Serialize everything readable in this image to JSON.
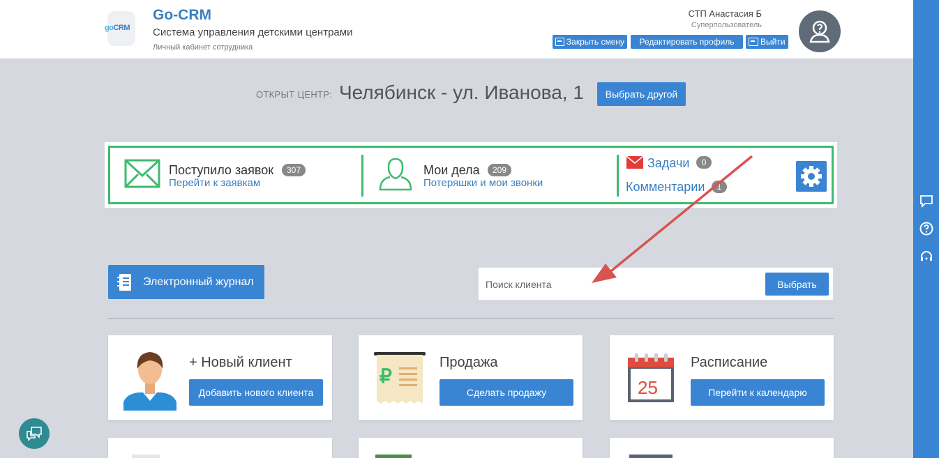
{
  "header": {
    "logo_text_1": "go",
    "logo_text_2": "CRM",
    "brand_title": "Go-CRM",
    "brand_subtitle": "Система управления детскими центрами",
    "brand_caption": "Личный кабинет сотрудника",
    "user_name": "СТП Анастасия Б",
    "user_role": "Суперпользователь",
    "buttons": {
      "close_shift": "Закрыть смену",
      "edit_profile": "Редактировать профиль",
      "logout": "Выйти"
    }
  },
  "center": {
    "label": "ОТКРЫТ ЦЕНТР:",
    "name": "Челябинск - ул. Иванова, 1",
    "choose_button": "Выбрать другой"
  },
  "stats": {
    "requests": {
      "title": "Поступило заявок",
      "count": "307",
      "link": "Перейти к заявкам"
    },
    "my_tasks": {
      "title": "Мои дела",
      "count": "209",
      "link": "Потеряшки и мои звонки"
    },
    "tasks": {
      "title": "Задачи",
      "count": "0"
    },
    "comments": {
      "title": "Комментарии",
      "count": "1"
    }
  },
  "journal_button": "Электронный журнал",
  "search": {
    "placeholder": "Поиск клиента",
    "button": "Выбрать"
  },
  "cards": [
    {
      "title": "+ Новый клиент",
      "button": "Добавить нового клиента"
    },
    {
      "title": "Продажа",
      "button": "Сделать продажу",
      "icon_symbol": "₽"
    },
    {
      "title": "Расписание",
      "button": "Перейти к календарю",
      "icon_day": "25"
    }
  ],
  "colors": {
    "accent": "#3a85d3",
    "green_frame": "#3dbb6f",
    "arrow": "#d9534f",
    "background": "#d5d8df"
  }
}
